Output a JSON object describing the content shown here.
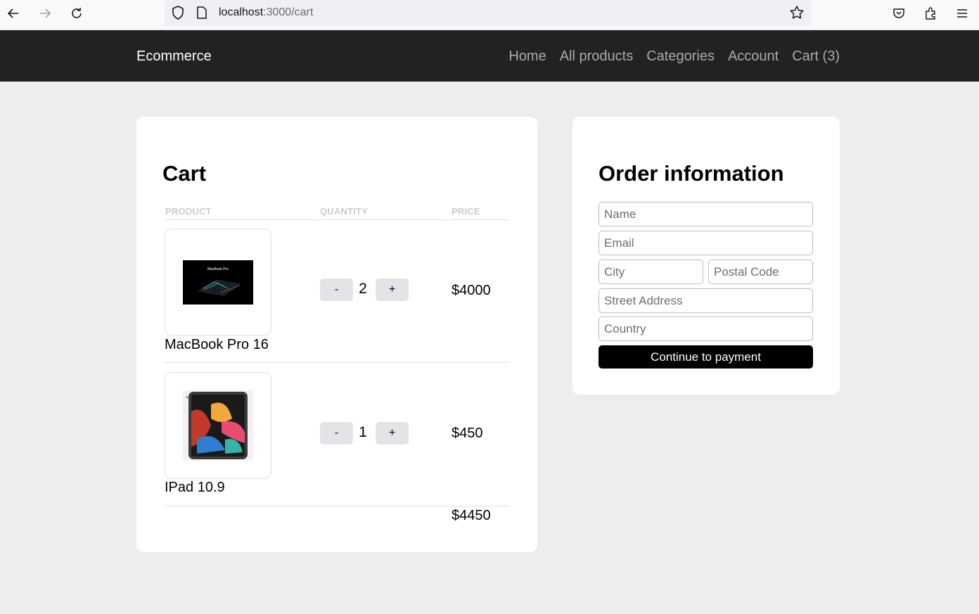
{
  "browser": {
    "url_host": "localhost",
    "url_path": ":3000/cart"
  },
  "site": {
    "logo": "Ecommerce",
    "nav": [
      "Home",
      "All products",
      "Categories",
      "Account",
      "Cart (3)"
    ]
  },
  "cart": {
    "title": "Cart",
    "columns": [
      "PRODUCT",
      "QUANTITY",
      "PRICE"
    ],
    "items": [
      {
        "name": "MacBook Pro 16",
        "quantity": "2",
        "price": "$4000",
        "image_label": "MacBook Pro"
      },
      {
        "name": "IPad 10.9",
        "quantity": "1",
        "price": "$450"
      }
    ],
    "decrement_label": "-",
    "increment_label": "+",
    "total": "$4450"
  },
  "order": {
    "title": "Order information",
    "placeholders": {
      "name": "Name",
      "email": "Email",
      "city": "City",
      "postal_code": "Postal Code",
      "street": "Street Address",
      "country": "Country"
    },
    "submit_label": "Continue to payment"
  },
  "colors": {
    "header_bg": "#222222",
    "page_bg": "#ededed",
    "button_primary": "#000000",
    "button_qty": "#e4e4e8"
  }
}
